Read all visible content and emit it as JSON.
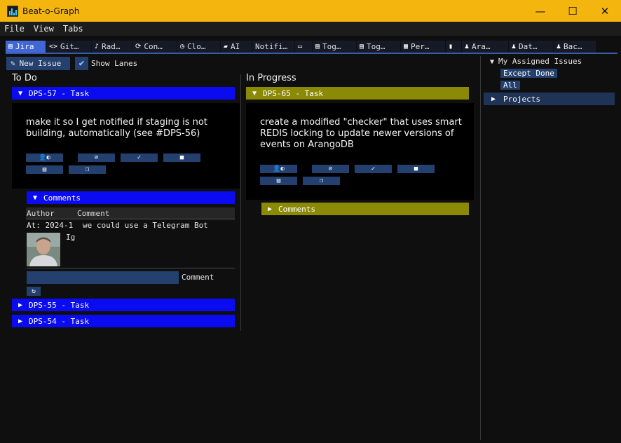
{
  "window": {
    "title": "Beat-o-Graph",
    "minimize": "—",
    "maximize": "☐",
    "close": "✕"
  },
  "menu": [
    "File",
    "View",
    "Tabs"
  ],
  "tabs": [
    {
      "icon": "▤",
      "label": "Jira",
      "icon_name": "document-icon"
    },
    {
      "icon": "<>",
      "label": "Git…",
      "icon_name": "code-icon"
    },
    {
      "icon": "♪",
      "label": "Rad…",
      "icon_name": "music-note-icon"
    },
    {
      "icon": "⟳",
      "label": "Con…",
      "icon_name": "sync-icon"
    },
    {
      "icon": "◷",
      "label": "Clo…",
      "icon_name": "watch-icon"
    },
    {
      "icon": "▰",
      "label": "AI",
      "icon_name": "chat-icon"
    },
    {
      "icon": "",
      "label": "Notifi…",
      "icon_name": ""
    },
    {
      "icon": "▭",
      "label": "",
      "icon_name": "laptop-icon"
    },
    {
      "icon": "▤",
      "label": "Tog…",
      "icon_name": "document-icon"
    },
    {
      "icon": "▤",
      "label": "Tog…",
      "icon_name": "document-check-icon"
    },
    {
      "icon": "▦",
      "label": "Per…",
      "icon_name": "calendar-icon"
    },
    {
      "icon": "▮",
      "label": "",
      "icon_name": "remote-icon"
    },
    {
      "icon": "♟",
      "label": "Ara…",
      "icon_name": "users-icon"
    },
    {
      "icon": "♟",
      "label": "Dat…",
      "icon_name": "users-icon"
    },
    {
      "icon": "♟",
      "label": "Bac…",
      "icon_name": "users-icon"
    }
  ],
  "toolbar": {
    "new_issue": "New Issue",
    "show_lanes": "Show Lanes",
    "show_lanes_checked": true
  },
  "lanes": {
    "todo": {
      "title": "To Do",
      "issue": {
        "header": "DPS-57 - Task",
        "text": "make it so I get notified if staging is not building, automatically (see #DPS-56)"
      },
      "comments": {
        "header": "Comments",
        "columns": [
          "Author",
          "Comment"
        ],
        "rows": [
          {
            "author": "At: 2024-1",
            "comment": "we could use a Telegram Bot",
            "author_name": "Ig"
          }
        ],
        "input_label": "Comment"
      },
      "collapsed": [
        "DPS-55 - Task",
        "DPS-54 - Task"
      ]
    },
    "inprogress": {
      "title": "In Progress",
      "issue": {
        "header": "DPS-65 - Task",
        "text": "create a modified \"checker\" that uses smart REDIS locking to update newer versions of events on ArangoDB"
      },
      "comments": {
        "header": "Comments"
      }
    }
  },
  "right_panel": {
    "assigned": "My Assigned Issues",
    "except_done": "Except Done",
    "all": "All",
    "projects": "Projects"
  },
  "colors": {
    "accent": "#f5b50f",
    "todo_header": "#0b0bf2",
    "progress_header": "#8b8a07",
    "button": "#24406e"
  }
}
